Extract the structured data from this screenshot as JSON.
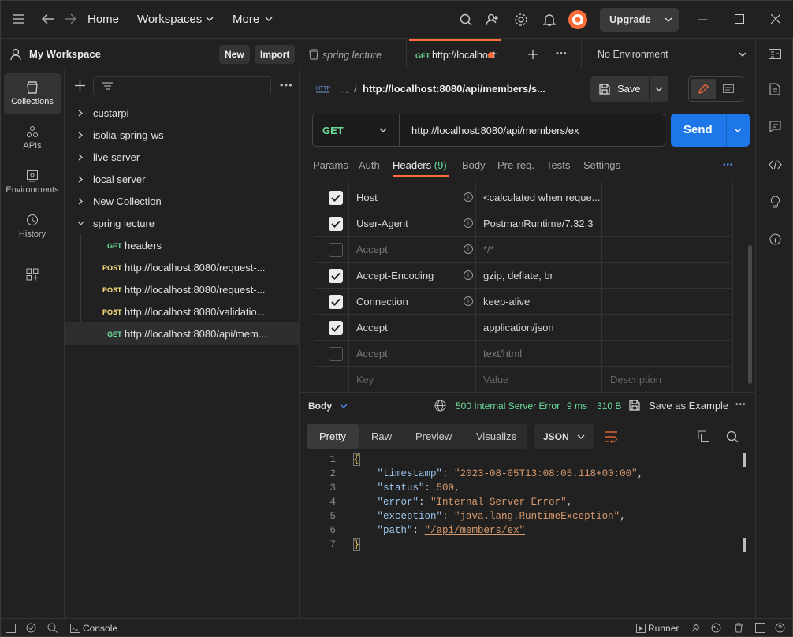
{
  "nav": {
    "home": "Home",
    "workspaces": "Workspaces",
    "more": "More",
    "upgrade": "Upgrade"
  },
  "workspace": {
    "name": "My Workspace",
    "new_label": "New",
    "import_label": "Import"
  },
  "rail": {
    "items": [
      {
        "label": "Collections",
        "icon": "collections-icon"
      },
      {
        "label": "APIs",
        "icon": "apis-icon"
      },
      {
        "label": "Environments",
        "icon": "environments-icon"
      },
      {
        "label": "History",
        "icon": "history-icon"
      }
    ]
  },
  "tree": {
    "collections": [
      "custarpi",
      "isolia-spring-ws",
      "live server",
      "local server",
      "New Collection",
      "spring lecture"
    ],
    "requests": [
      {
        "method": "GET",
        "label": "headers"
      },
      {
        "method": "POST",
        "label": "http://localhost:8080/request-..."
      },
      {
        "method": "POST",
        "label": "http://localhost:8080/request-..."
      },
      {
        "method": "POST",
        "label": "http://localhost:8080/validatio..."
      },
      {
        "method": "GET",
        "label": "http://localhost:8080/api/mem..."
      }
    ]
  },
  "tabs": {
    "tab1": "spring lecture",
    "tab2_method": "GET",
    "tab2": "http://localhost:",
    "environment": "No Environment"
  },
  "request": {
    "breadcrumb_ellipsis": "...",
    "breadcrumb_sep": "/",
    "title": "http://localhost:8080/api/members/s...",
    "save_label": "Save",
    "method": "GET",
    "url": "http://localhost:8080/api/members/ex",
    "send_label": "Send"
  },
  "subtabs": {
    "params": "Params",
    "auth": "Auth",
    "headers": "Headers",
    "headers_count": "(9)",
    "body": "Body",
    "prereq": "Pre-req.",
    "tests": "Tests",
    "settings": "Settings"
  },
  "headers_table": {
    "rows": [
      {
        "key": "Host",
        "value": "<calculated when reque...",
        "checked": true
      },
      {
        "key": "User-Agent",
        "value": "PostmanRuntime/7.32.3",
        "checked": true
      },
      {
        "key": "Accept",
        "value": "*/*",
        "checked": false
      },
      {
        "key": "Accept-Encoding",
        "value": "gzip, deflate, br",
        "checked": true
      },
      {
        "key": "Connection",
        "value": "keep-alive",
        "checked": true
      },
      {
        "key": "Accept",
        "value": "application/json",
        "checked": true
      },
      {
        "key": "Accept",
        "value": "text/html",
        "checked": false
      }
    ],
    "placeholder_key": "Key",
    "placeholder_value": "Value",
    "placeholder_desc": "Description"
  },
  "response": {
    "body_label": "Body",
    "status": "500 Internal Server Error",
    "time": "9 ms",
    "size": "310 B",
    "save_example": "Save as Example",
    "views": [
      "Pretty",
      "Raw",
      "Preview",
      "Visualize"
    ],
    "format": "JSON",
    "lines": [
      {
        "n": "1",
        "t": "{"
      },
      {
        "n": "2",
        "k": "\"timestamp\"",
        "v": "\"2023-08-05T13:08:05.118+00:00\"",
        "c": ","
      },
      {
        "n": "3",
        "k": "\"status\"",
        "v": "500",
        "c": ","
      },
      {
        "n": "4",
        "k": "\"error\"",
        "v": "\"Internal Server Error\"",
        "c": ","
      },
      {
        "n": "5",
        "k": "\"exception\"",
        "v": "\"java.lang.RuntimeException\"",
        "c": ","
      },
      {
        "n": "6",
        "k": "\"path\"",
        "v": "\"/api/members/ex\"",
        "c": ""
      },
      {
        "n": "7",
        "t": "}"
      }
    ]
  },
  "statusbar": {
    "console": "Console",
    "runner": "Runner"
  },
  "colors": {
    "accent": "#ff6c37",
    "send": "#1d77e8",
    "get": "#6bdd9a",
    "post": "#ffe47e",
    "ok": "#6bdd9a"
  }
}
